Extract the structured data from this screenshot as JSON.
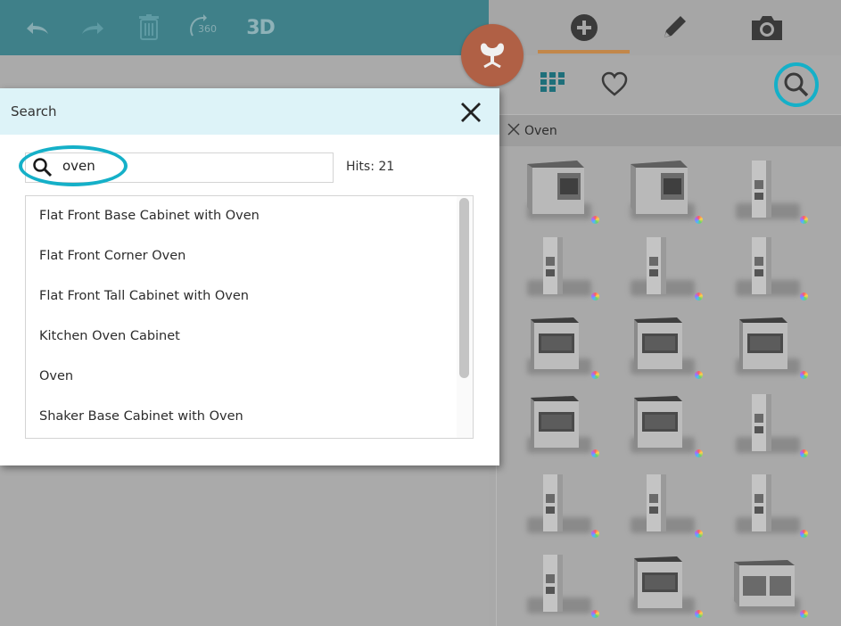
{
  "toolbar": {
    "icons": [
      "undo-icon",
      "redo-icon",
      "trash-icon",
      "rotate-360-icon"
    ],
    "rotate_label": "360",
    "view_3d_label": "3D"
  },
  "right_panel": {
    "tabs": [
      "add-icon",
      "pencil-icon",
      "camera-icon"
    ],
    "active_tab": "add-icon",
    "view_icons": [
      "grid-view-icon",
      "heart-icon",
      "search-icon"
    ],
    "filter": {
      "label": "Oven"
    },
    "catalog_items": [
      "base-oven-cabinet",
      "base-oven-cabinet",
      "tall-oven-cabinet",
      "tall-oven-cabinet",
      "tall-oven-cabinet",
      "tall-oven-cabinet",
      "range-oven",
      "range-oven",
      "range-oven",
      "range-oven",
      "range-oven",
      "tall-oven-cabinet",
      "tall-oven-cabinet",
      "tall-oven-cabinet",
      "tall-oven-cabinet",
      "tall-oven-cabinet",
      "range-oven",
      "double-range-oven"
    ]
  },
  "floating_button": {
    "icon": "chair-icon"
  },
  "dialog": {
    "title": "Search",
    "search": {
      "value": "oven",
      "placeholder": ""
    },
    "hits_label": "Hits: 21",
    "results": [
      "Flat Front Base Cabinet with Oven",
      "Flat Front Corner Oven",
      "Flat Front Tall Cabinet with Oven",
      "Kitchen Oven Cabinet",
      "Oven",
      "Shaker Base Cabinet with Oven"
    ]
  },
  "colors": {
    "toolbar": "#3f8089",
    "accent_tab": "#c2874a",
    "highlight": "#15b0c8",
    "chair_bubble": "#b06045",
    "dialog_header": "#ddf3f8"
  }
}
